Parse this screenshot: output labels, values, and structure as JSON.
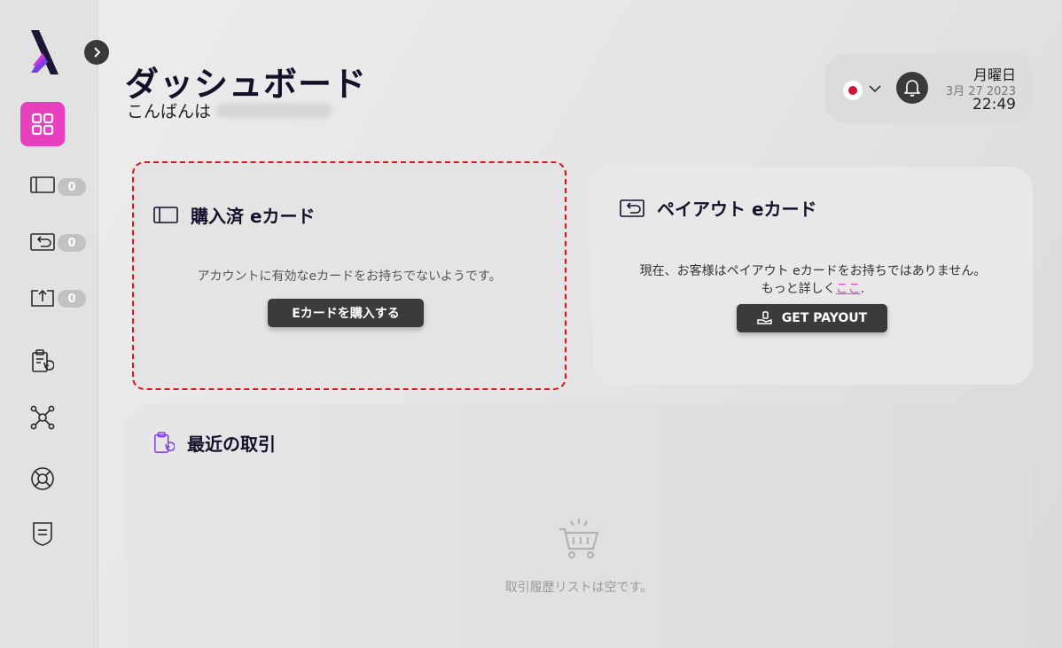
{
  "header": {
    "title": "ダッシュボード",
    "greeting": "こんばんは"
  },
  "widget": {
    "language": "Japanese",
    "day": "月曜日",
    "date": "3月 27 2023",
    "time": "22:49"
  },
  "sidebar": {
    "items": [
      {
        "icon": "dashboard-grid-icon",
        "active": true
      },
      {
        "icon": "card-icon",
        "badge": "0"
      },
      {
        "icon": "payout-card-icon",
        "badge": "0"
      },
      {
        "icon": "upload-card-icon",
        "badge": "0"
      },
      {
        "icon": "clipboard-history-icon"
      },
      {
        "icon": "network-icon"
      },
      {
        "icon": "lifebuoy-icon"
      },
      {
        "icon": "shield-doc-icon"
      }
    ]
  },
  "purchased_card": {
    "title": "購入済 eカード",
    "message": "アカウントに有効なeカードをお持ちでないようです。",
    "button": "Eカードを購入する"
  },
  "payout_card": {
    "title": "ペイアウト eカード",
    "message_line1": "現在、お客様はペイアウト eカードをお持ちではありません。",
    "message_line2_prefix": "もっと詳しく",
    "link": "ここ",
    "message_line2_suffix": ".",
    "button": "GET PAYOUT"
  },
  "recent": {
    "title": "最近の取引",
    "empty": "取引履歴リストは空です。"
  },
  "colors": {
    "accent": "#e83fbf",
    "dark": "#3b3b3b",
    "highlight_border": "#d7141f",
    "title": "#14102a"
  }
}
